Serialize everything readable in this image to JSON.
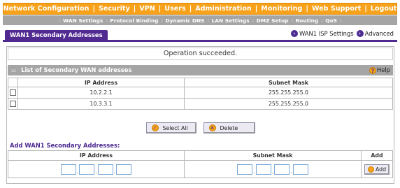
{
  "top_nav": [
    "Network Configuration",
    "Security",
    "VPN",
    "Users",
    "Administration",
    "Monitoring",
    "Web Support",
    "Logout"
  ],
  "sub_nav": [
    "WAN Settings",
    "Protocol Binding",
    "Dynamic DNS",
    "LAN Settings",
    "DMZ Setup",
    "Routing",
    "QoS"
  ],
  "page_tab": "WAN1 Secondary Addresses",
  "links": {
    "isp_settings": "WAN1 ISP Settings",
    "advanced": "Advanced"
  },
  "status_message": "Operation succeeded.",
  "list": {
    "title": "List of Secondary WAN addresses",
    "help": "Help",
    "columns": [
      "IP Address",
      "Subnet Mask"
    ],
    "rows": [
      {
        "ip": "10.2.2.1",
        "mask": "255.255.255.0"
      },
      {
        "ip": "10.3.3.1",
        "mask": "255.255.255.0"
      }
    ]
  },
  "buttons": {
    "select_all": "Select All",
    "delete": "Delete",
    "add": "Add"
  },
  "add_section": {
    "title": "Add WAN1 Secondary Addresses:",
    "columns": [
      "IP Address",
      "Subnet Mask",
      "Add"
    ],
    "ip_value": [
      "",
      "",
      "",
      ""
    ],
    "mask_value": [
      "",
      "",
      "",
      ""
    ]
  },
  "colors": {
    "accent_orange": "#f7a21a",
    "accent_purple": "#512a91",
    "subnav_gray": "#a5a5a5"
  }
}
